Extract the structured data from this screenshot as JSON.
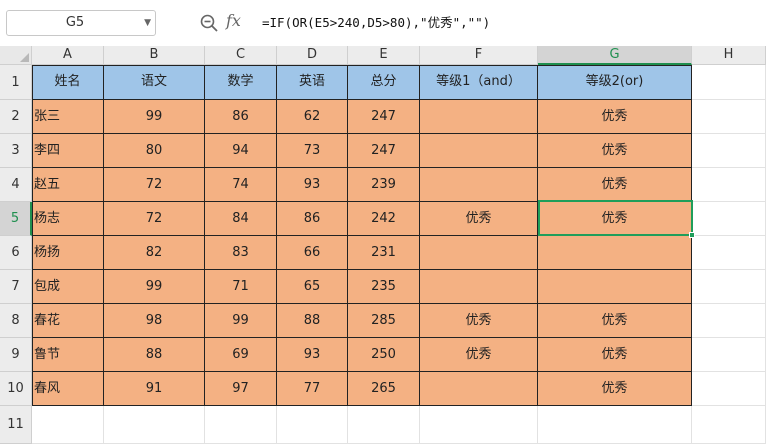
{
  "formula_bar": {
    "name_box": "G5",
    "fx_label": "fx",
    "formula": "=IF(OR(E5>240,D5>80),\"优秀\",\"\")"
  },
  "columns": [
    "A",
    "B",
    "C",
    "D",
    "E",
    "F",
    "G",
    "H"
  ],
  "rows": [
    "1",
    "2",
    "3",
    "4",
    "5",
    "6",
    "7",
    "8",
    "9",
    "10",
    "11"
  ],
  "active_cell": {
    "column": "G",
    "row": "5"
  },
  "table": {
    "headers": [
      "姓名",
      "语文",
      "数学",
      "英语",
      "总分",
      "等级1（and）",
      "等级2(or)"
    ],
    "rows": [
      [
        "张三",
        "99",
        "86",
        "62",
        "247",
        "",
        "优秀"
      ],
      [
        "李四",
        "80",
        "94",
        "73",
        "247",
        "",
        "优秀"
      ],
      [
        "赵五",
        "72",
        "74",
        "93",
        "239",
        "",
        "优秀"
      ],
      [
        "杨志",
        "72",
        "84",
        "86",
        "242",
        "优秀",
        "优秀"
      ],
      [
        "杨扬",
        "82",
        "83",
        "66",
        "231",
        "",
        ""
      ],
      [
        "包成",
        "99",
        "71",
        "65",
        "235",
        "",
        ""
      ],
      [
        "春花",
        "98",
        "99",
        "88",
        "285",
        "优秀",
        "优秀"
      ],
      [
        "鲁节",
        "88",
        "69",
        "93",
        "250",
        "优秀",
        "优秀"
      ],
      [
        "春风",
        "91",
        "97",
        "77",
        "265",
        "",
        "优秀"
      ]
    ]
  },
  "colors": {
    "header_fill": "#9fc5e8",
    "body_fill": "#f4b183",
    "selection": "#1f9e5a"
  }
}
